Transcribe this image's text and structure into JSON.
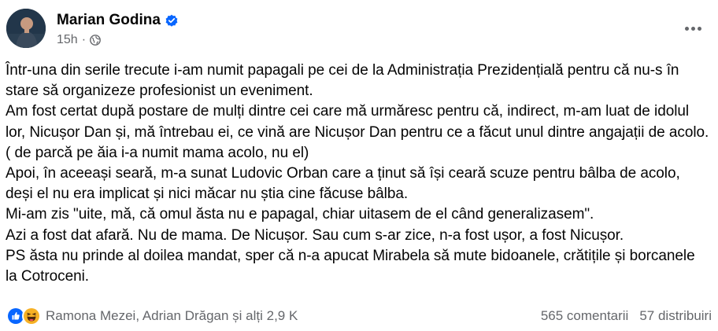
{
  "post": {
    "author": "Marian Godina",
    "verified": true,
    "time": "15h",
    "separator": "·",
    "privacy_icon": "globe-icon",
    "more_icon": "more-options-icon",
    "paragraphs": [
      "Într-una din serile trecute i-am numit papagali pe cei de la Administrația Prezidențială pentru că nu-s în stare să organizeze profesionist un eveniment.",
      "Am fost certat după postare de mulți dintre cei care mă urmăresc pentru că, indirect, m-am luat de idolul lor, Nicușor Dan și, mă întrebau ei, ce vină are Nicușor Dan pentru ce a făcut unul dintre angajații de acolo. ( de parcă pe ăia i-a numit mama acolo, nu el)",
      "Apoi, în aceeași seară, m-a sunat Ludovic Orban care a ținut să își ceară scuze pentru bâlba de acolo, deși el nu era implicat și nici măcar nu știa cine făcuse bâlba.",
      "Mi-am zis \"uite, mă, că omul ăsta nu e papagal, chiar uitasem de el când generalizasem\".",
      "Azi a fost dat afară. Nu de mama. De Nicușor. Sau cum s-ar zice, n-a fost ușor, a fost Nicușor.",
      "PS ăsta nu prinde al doilea mandat, sper că n-a apucat Mirabela să mute bidoanele, crătițile și borcanele la Cotroceni."
    ]
  },
  "footer": {
    "reaction_icons": [
      "like-reaction-icon",
      "haha-reaction-icon"
    ],
    "reactors": "Ramona Mezei, Adrian Drăgan și alți 2,9 K",
    "comments": "565 comentarii",
    "shares": "57 distribuiri"
  },
  "colors": {
    "text": "#050505",
    "secondary": "#65676b",
    "verified": "#0866ff",
    "like": "#0866ff",
    "haha": "#f7b125"
  }
}
